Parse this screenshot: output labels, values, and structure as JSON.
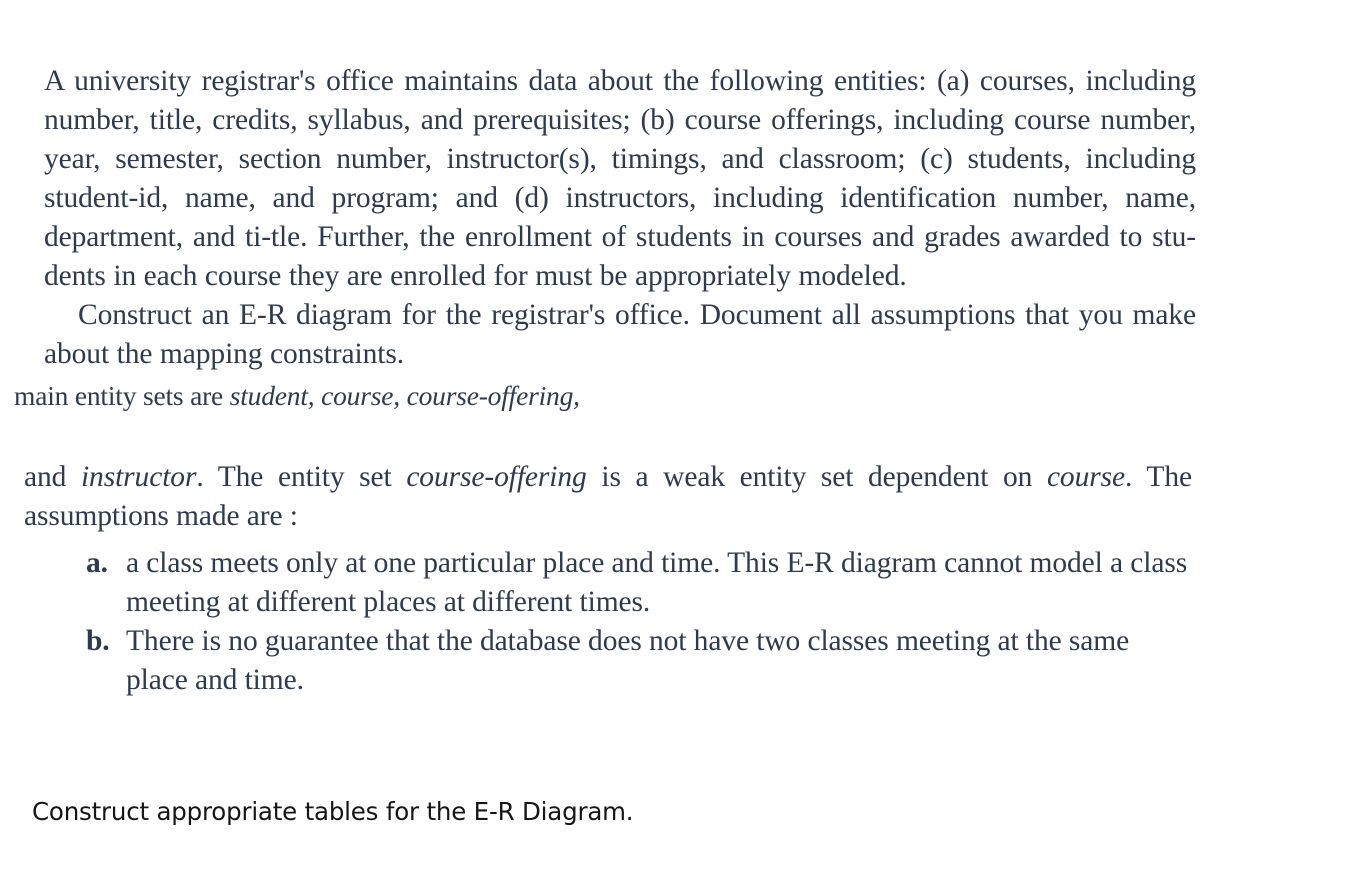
{
  "document": {
    "background_color": "#ffffff",
    "scan_text_color": "#2f3b4d",
    "question_text_color": "#161616",
    "excerpt": {
      "paragraph_1": "A university registrar's office maintains data about the following entities: (a) courses, including number, title, credits, syllabus, and prerequisites; (b) course offerings, including course number, year, semester, section number, instructor(s), timings, and classroom; (c) students, including student-id, name, and program; and (d) instructors, including identification number, name, department, and ti-tle. Further, the enrollment of students in courses and grades awarded to stu-dents in each course they are enrolled for must be appropriately modeled.",
      "paragraph_2": "Construct an E-R diagram for the registrar's office. Document all assumptions that you make about the mapping constraints.",
      "entity_sets_line": {
        "lead": "main entity sets are ",
        "entities": "student, course, course-offering,"
      },
      "paragraph_3": {
        "part_1": "and ",
        "italic_1": "instructor",
        "part_2": ". The entity set ",
        "italic_2": "course-offering",
        "part_3": " is a weak entity set dependent on ",
        "italic_3": "course",
        "part_4": ". The assumptions made are :"
      },
      "assumptions": [
        {
          "marker": "a.",
          "text": "a class meets only at one particular place and time. This E-R diagram cannot model a class meeting at different places at different times."
        },
        {
          "marker": "b.",
          "text": "There is no guarantee that the database does not have two classes meeting at the same place and time."
        }
      ]
    },
    "question": "Construct appropriate tables for the E-R Diagram."
  }
}
